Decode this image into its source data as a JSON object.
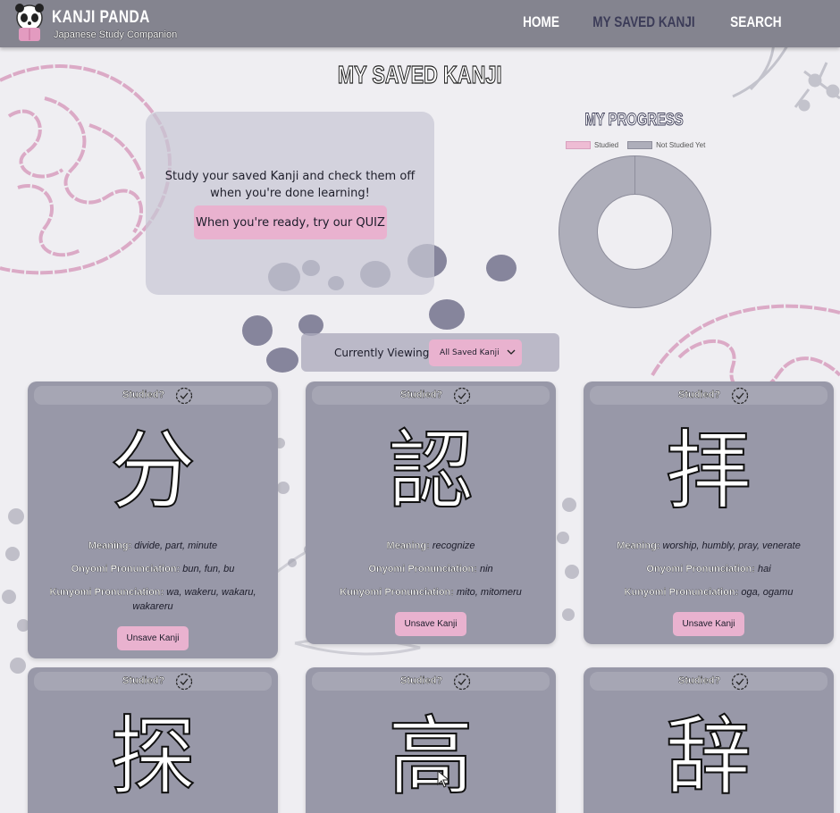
{
  "nav": {
    "brand": "KANJI PANDA",
    "tagline": "Japanese Study Companion",
    "links": [
      "HOME",
      "MY SAVED KANJI",
      "SEARCH"
    ],
    "active": "MY SAVED KANJI"
  },
  "page_title": "MY SAVED KANJI",
  "intro": {
    "text": "Study your saved Kanji and check them off when you're done learning!",
    "quiz_button": "When you're ready, try our QUIZ"
  },
  "progress": {
    "title": "MY PROGRESS",
    "legend": [
      "Studied",
      "Not Studied Yet"
    ],
    "studied_color": "#eebcd4",
    "not_studied_color": "#aeaeba"
  },
  "chart_data": {
    "type": "pie",
    "labels": [
      "Studied",
      "Not Studied Yet"
    ],
    "values": [
      0,
      6
    ],
    "legend": "top"
  },
  "filter": {
    "label": "Currently Viewing:",
    "selected": "All Saved Kanji"
  },
  "labels": {
    "studied": "Studied?",
    "meaning": "Meaning:",
    "onyomi": "Onyomi Pronunciation:",
    "kunyomi": "Kunyomi Pronunciation:",
    "unsave": "Unsave Kanji"
  },
  "cards": [
    {
      "kanji": "分",
      "meaning": "divide, part, minute",
      "onyomi": "bun, fun, bu",
      "kunyomi": "wa, wakeru, wakaru, wakareru"
    },
    {
      "kanji": "認",
      "meaning": "recognize",
      "onyomi": "nin",
      "kunyomi": "mito, mitomeru"
    },
    {
      "kanji": "拝",
      "meaning": "worship, humbly, pray, venerate",
      "onyomi": "hai",
      "kunyomi": "oga, ogamu"
    },
    {
      "kanji": "探"
    },
    {
      "kanji": "高"
    },
    {
      "kanji": "辞"
    }
  ],
  "colors": {
    "nav": "#84848f",
    "card": "#9898a8",
    "accent_pink": "#e9b2cf",
    "page_bg": "#efeef2"
  }
}
